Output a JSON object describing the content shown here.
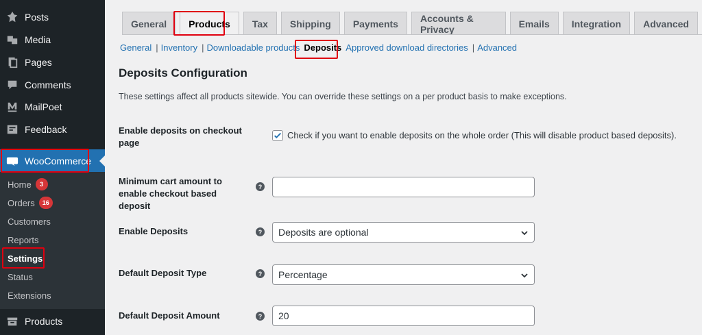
{
  "sidebar": {
    "items": [
      {
        "label": "Posts",
        "icon": "pin-icon"
      },
      {
        "label": "Media",
        "icon": "media-icon"
      },
      {
        "label": "Pages",
        "icon": "pages-icon"
      },
      {
        "label": "Comments",
        "icon": "comment-icon"
      },
      {
        "label": "MailPoet",
        "icon": "mailpoet-icon"
      },
      {
        "label": "Feedback",
        "icon": "feedback-icon"
      },
      {
        "label": "WooCommerce",
        "icon": "woo-icon"
      }
    ],
    "submenu": [
      {
        "label": "Home",
        "count": "3"
      },
      {
        "label": "Orders",
        "count": "16"
      },
      {
        "label": "Customers"
      },
      {
        "label": "Reports"
      },
      {
        "label": "Settings"
      },
      {
        "label": "Status"
      },
      {
        "label": "Extensions"
      }
    ],
    "products_label": "Products"
  },
  "tabs": [
    "General",
    "Products",
    "Tax",
    "Shipping",
    "Payments",
    "Accounts & Privacy",
    "Emails",
    "Integration",
    "Advanced"
  ],
  "subnav": [
    "General",
    "Inventory",
    "Downloadable products",
    "Deposits",
    "Approved download directories",
    "Advanced"
  ],
  "section": {
    "title": "Deposits Configuration",
    "description": "These settings affect all products sitewide. You can override these settings on a per product basis to make exceptions."
  },
  "fields": {
    "checkout_label": "Enable deposits on checkout page",
    "checkout_checkbox_text": "Check if you want to enable deposits on the whole order (This will disable product based deposits).",
    "min_cart_label": "Minimum cart amount to enable checkout based deposit",
    "min_cart_value": "",
    "enable_label": "Enable Deposits",
    "enable_value": "Deposits are optional",
    "type_label": "Default Deposit Type",
    "type_value": "Percentage",
    "amount_label": "Default Deposit Amount",
    "amount_value": "20"
  },
  "colors": {
    "accent": "#2271b1",
    "highlight": "#e0000f",
    "badge": "#d63638"
  }
}
